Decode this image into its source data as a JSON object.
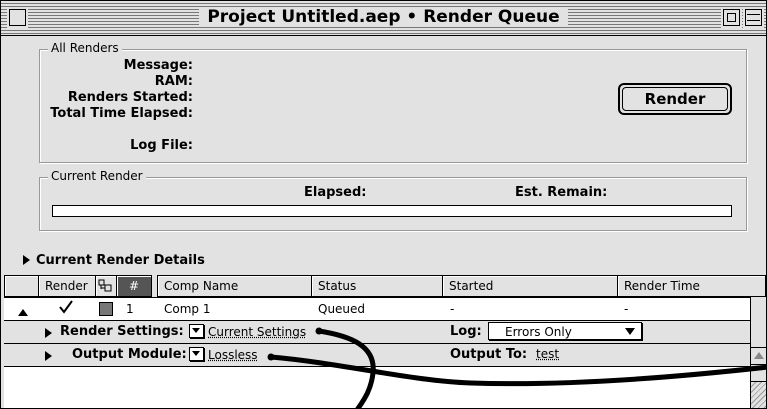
{
  "window": {
    "title": "Project Untitled.aep • Render Queue"
  },
  "all_renders": {
    "group_label": "All Renders",
    "message_label": "Message:",
    "ram_label": "RAM:",
    "renders_started_label": "Renders Started:",
    "total_time_label": "Total Time Elapsed:",
    "log_file_label": "Log File:",
    "render_button": "Render"
  },
  "current_render": {
    "group_label": "Current Render",
    "elapsed_label": "Elapsed:",
    "est_remain_label": "Est. Remain:",
    "progress": 0
  },
  "details_toggle": "Current Render Details",
  "columns": {
    "render": "Render",
    "label_icon": "label-icon",
    "number": "#",
    "comp_name": "Comp Name",
    "status": "Status",
    "started": "Started",
    "render_time": "Render Time"
  },
  "queue_item": {
    "checked": true,
    "number": "1",
    "comp_name": "Comp 1",
    "status": "Queued",
    "started": "-",
    "render_time": "-",
    "render_settings_label": "Render Settings:",
    "render_settings_value": "Current Settings",
    "log_label": "Log:",
    "log_value": "Errors Only",
    "output_module_label": "Output Module:",
    "output_module_value": "Lossless",
    "output_to_label": "Output To:",
    "output_to_value": "test"
  },
  "colors": {
    "window_bg": "#e2e2e2",
    "label_swatch": "#777777",
    "stroke": "#000000"
  }
}
